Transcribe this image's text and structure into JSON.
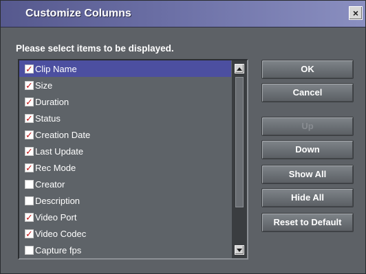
{
  "window": {
    "title": "Customize Columns",
    "close_label": "×"
  },
  "prompt": "Please select items to be displayed.",
  "columns": [
    {
      "label": "Clip Name",
      "checked": true,
      "selected": true
    },
    {
      "label": "Size",
      "checked": true,
      "selected": false
    },
    {
      "label": "Duration",
      "checked": true,
      "selected": false
    },
    {
      "label": "Status",
      "checked": true,
      "selected": false
    },
    {
      "label": "Creation Date",
      "checked": true,
      "selected": false
    },
    {
      "label": "Last Update",
      "checked": true,
      "selected": false
    },
    {
      "label": "Rec Mode",
      "checked": true,
      "selected": false
    },
    {
      "label": "Creator",
      "checked": false,
      "selected": false
    },
    {
      "label": "Description",
      "checked": false,
      "selected": false
    },
    {
      "label": "Video Port",
      "checked": true,
      "selected": false
    },
    {
      "label": "Video Codec",
      "checked": true,
      "selected": false
    },
    {
      "label": "Capture fps",
      "checked": false,
      "selected": false
    }
  ],
  "buttons": {
    "ok": "OK",
    "cancel": "Cancel",
    "up": "Up",
    "down": "Down",
    "show_all": "Show All",
    "hide_all": "Hide All",
    "reset": "Reset to Default"
  },
  "colors": {
    "title_bar": "#6b6fa5",
    "selection": "#4c4fa0",
    "check_mark": "#c01818",
    "dialog_bg": "#5d6166"
  }
}
